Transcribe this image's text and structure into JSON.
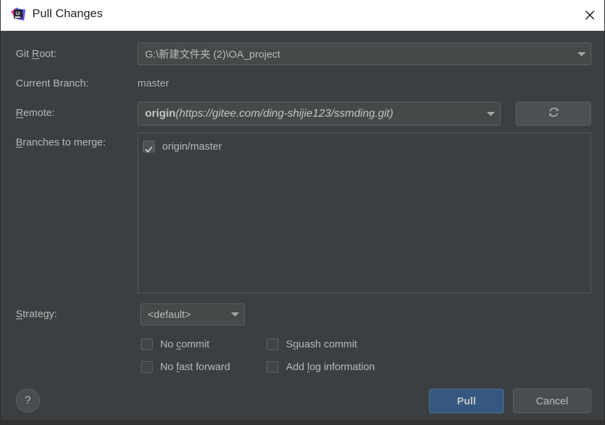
{
  "window": {
    "title": "Pull Changes",
    "app_icon": "intellij-idea-icon",
    "close_icon": "close-icon",
    "titlebar_bg": "#ffffff",
    "dialog_bg": "#3c3f41"
  },
  "fields": {
    "git_root": {
      "label_pre": "Git ",
      "label_mnemonic": "R",
      "label_post": "oot:",
      "value": "G:\\新建文件夹 (2)\\OA_project",
      "dropdown_icon": "chevron-down-icon"
    },
    "current_branch": {
      "label": "Current Branch:",
      "value": "master"
    },
    "remote": {
      "label_pre": "R",
      "label_mnemonic": "R",
      "label_post": "emote:",
      "label_full": "Remote:",
      "value_name": "origin",
      "value_url": "(https://gitee.com/ding-shijie123/ssmding.git)",
      "dropdown_icon": "chevron-down-icon",
      "refresh_icon": "refresh-icon"
    },
    "branches_to_merge": {
      "label_mnemonic": "B",
      "label_post": "ranches to merge:",
      "items": [
        {
          "name": "origin/master",
          "checked": true
        }
      ]
    },
    "strategy": {
      "label_mnemonic": "S",
      "label_post": "trategy:",
      "value": "<default>",
      "dropdown_icon": "chevron-down-icon"
    }
  },
  "options": [
    {
      "label_pre": "No ",
      "mnemonic": "c",
      "label_post": "ommit",
      "checked": false
    },
    {
      "label_pre": "S",
      "mnemonic": "q",
      "label_post": "uash commit",
      "checked": false
    },
    {
      "label_pre": "No ",
      "mnemonic": "f",
      "label_post": "ast forward",
      "checked": false
    },
    {
      "label_pre": "Add ",
      "mnemonic": "l",
      "label_post": "og information",
      "checked": false
    }
  ],
  "footer": {
    "help_label": "?",
    "help_icon": "question-mark-icon",
    "pull_label": "Pull",
    "cancel_label": "Cancel",
    "primary_color": "#365880"
  }
}
